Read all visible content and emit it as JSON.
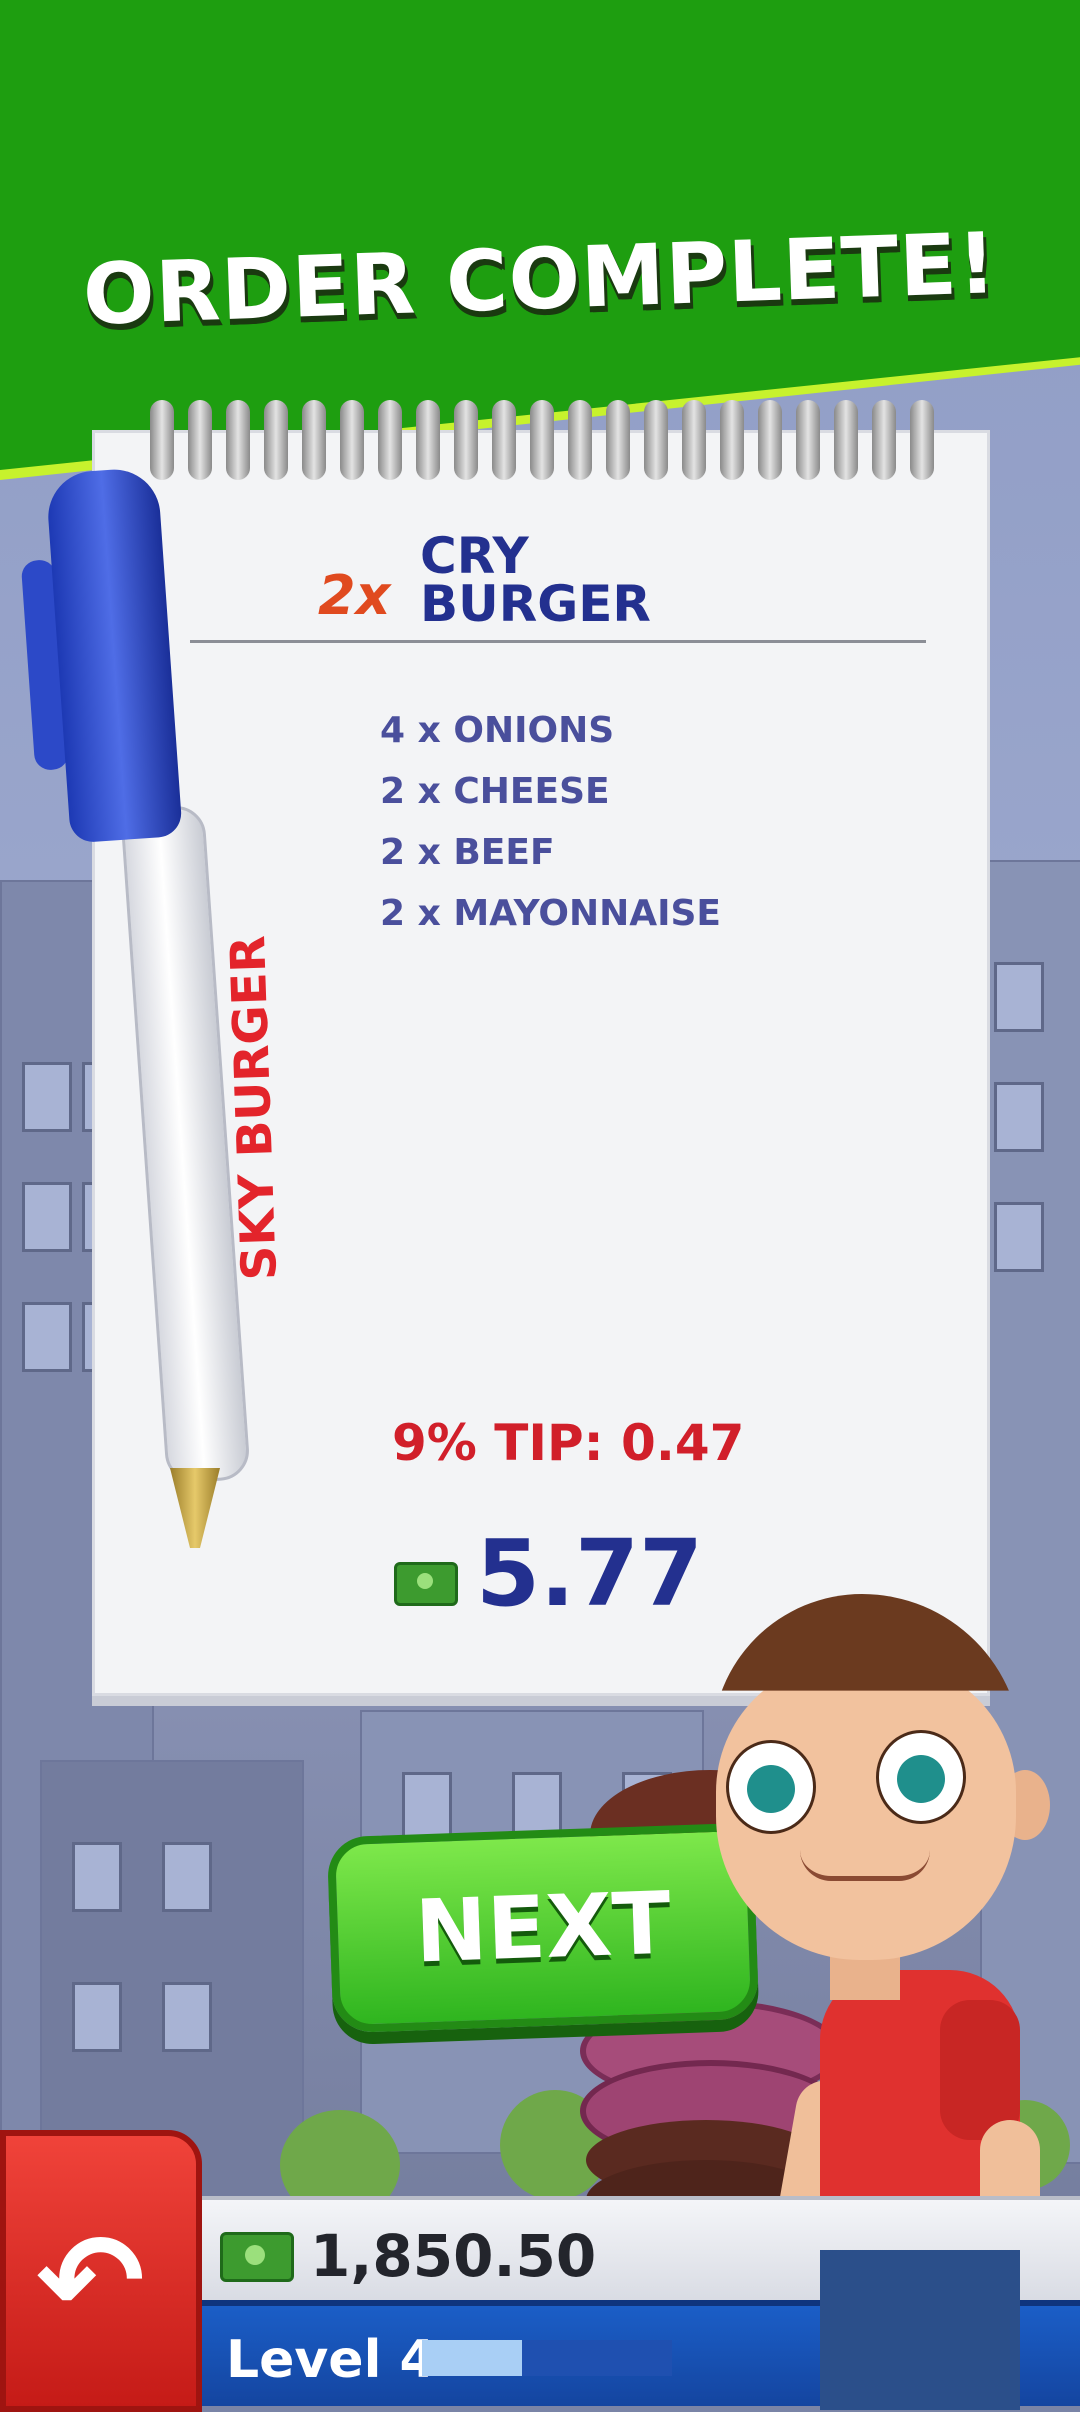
{
  "header": {
    "title": "ORDER COMPLETE!"
  },
  "order": {
    "quantity": "2x",
    "item_name": "CRY BURGER",
    "ingredients": [
      "4 x ONIONS",
      "2 x CHEESE",
      "2 x BEEF",
      "2 x MAYONNAISE"
    ],
    "tip": "9% TIP: 0.47",
    "total": "5.77"
  },
  "pen": {
    "brand": "SKY BURGER"
  },
  "next_button": {
    "label": "NEXT"
  },
  "status": {
    "cash": "1,850.50",
    "level_label": "Level 4",
    "level_progress_percent": 40
  },
  "icons": {
    "back": "back-arrow-icon",
    "cash": "money-icon"
  },
  "colors": {
    "header_green": "#1e9e10",
    "stripe_lime": "#c7f22d",
    "title_navy": "#23308f",
    "tip_red": "#d11f2a",
    "button_green": "#2fb51f",
    "back_red": "#c51b17",
    "level_blue": "#1445a0"
  }
}
